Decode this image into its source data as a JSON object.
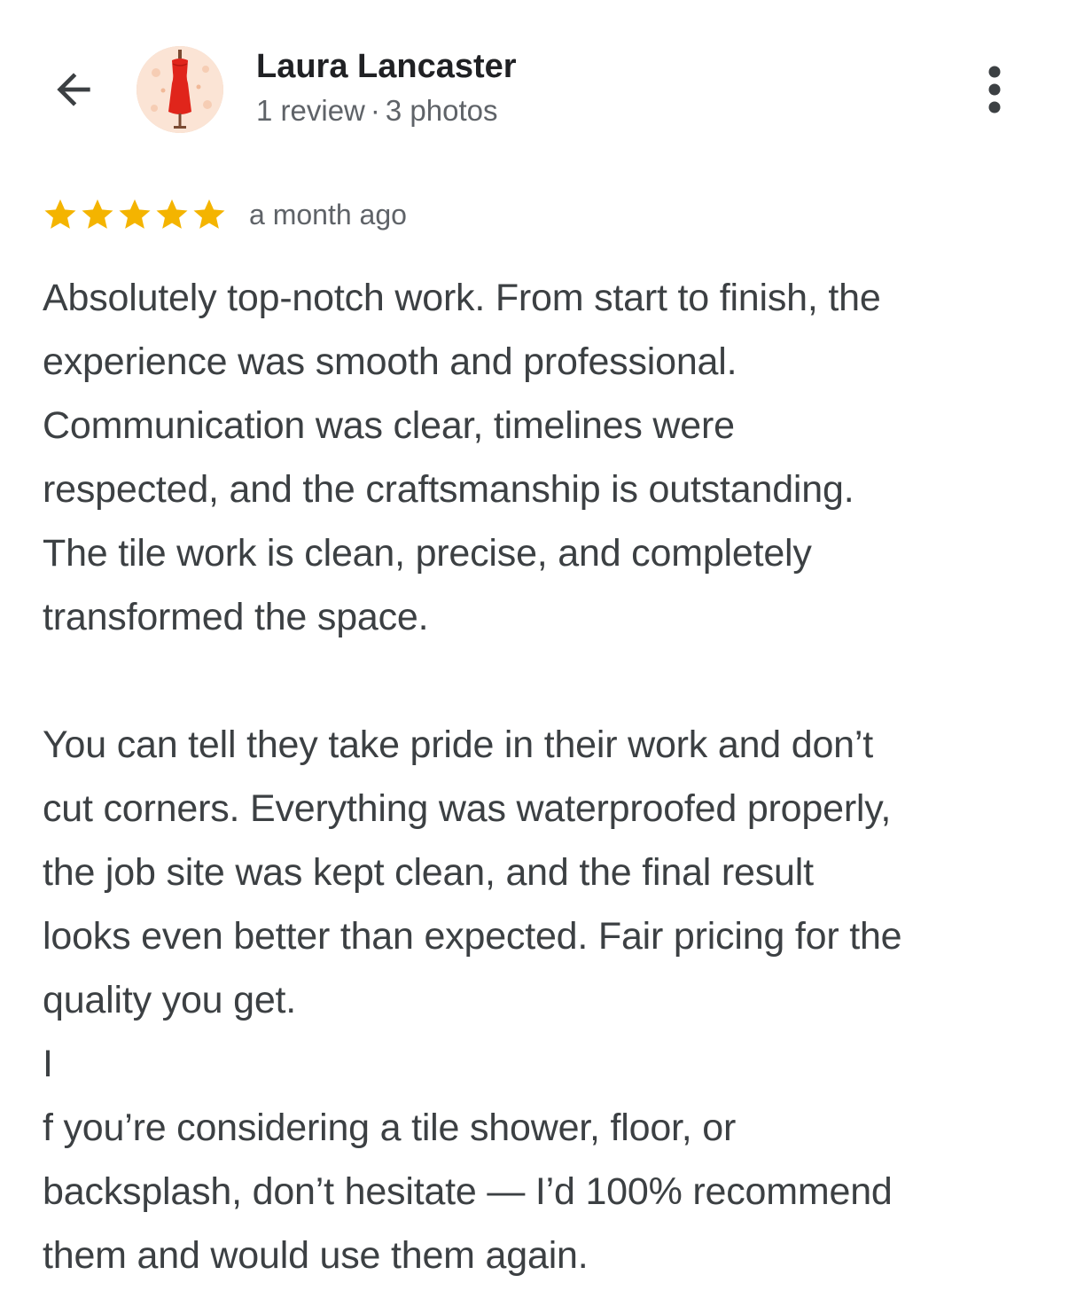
{
  "header": {
    "back_icon": "arrow-back-icon",
    "avatar_icon": "dress-mannequin-avatar",
    "reviewer_name": "Laura Lancaster",
    "review_count": "1 review",
    "separator": "·",
    "photo_count": "3 photos",
    "more_icon": "more-vert-icon"
  },
  "review": {
    "rating": 5,
    "rating_max": 5,
    "star_color": "#f4b400",
    "time_ago": "a month ago",
    "paragraph1_lines": [
      "Absolutely top-notch work. From start to finish, the",
      "experience was smooth and professional.",
      "Communication was clear, timelines were",
      "respected, and the craftsmanship is outstanding.",
      "The tile work is clean, precise, and completely",
      "transformed the space."
    ],
    "paragraph2_lines": [
      "You can tell they take pride in their work and don’t",
      "cut corners. Everything was waterproofed properly,",
      "the job site was kept clean, and the final result",
      "looks even better than expected. Fair pricing for the",
      "quality you get.",
      "I",
      "f you’re considering a tile shower, floor, or",
      "backsplash, don’t hesitate — I’d 100% recommend",
      "them and would use them again."
    ]
  }
}
